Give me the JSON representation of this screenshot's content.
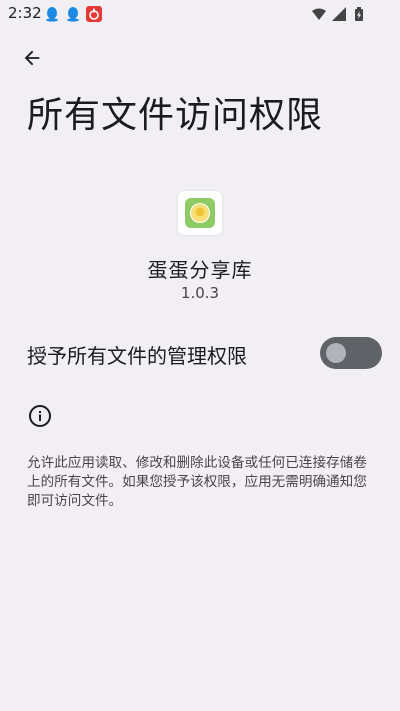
{
  "status_bar": {
    "time": "2:32",
    "notification_icons": [
      "qq-icon",
      "qq-icon",
      "app-notification-icon"
    ],
    "system_icons": [
      "wifi-icon",
      "signal-icon",
      "battery-icon"
    ]
  },
  "header": {
    "back_icon": "arrow-back-icon",
    "title": "所有文件访问权限"
  },
  "app": {
    "name": "蛋蛋分享库",
    "version": "1.0.3",
    "icon": "app-icon"
  },
  "permission": {
    "label": "授予所有文件的管理权限",
    "enabled": false
  },
  "info": {
    "icon": "info-icon",
    "description": "允许此应用读取、修改和删除此设备或任何已连接存储卷上的所有文件。如果您授予该权限，应用无需明确通知您即可访问文件。"
  },
  "colors": {
    "background": "#F2EFF4",
    "toggle_track_off": "#5F6368",
    "toggle_thumb_off": "#B0B3B8",
    "app_icon_accent": "#8FCB65",
    "notification_blue": "#1E88E5",
    "notification_red": "#E53935"
  }
}
